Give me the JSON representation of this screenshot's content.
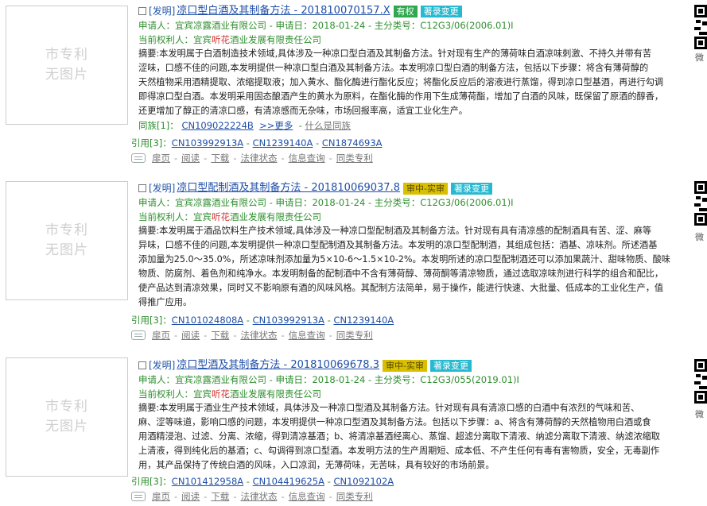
{
  "placeholder": {
    "line1": "市专利",
    "line2": "无图片"
  },
  "entries": [
    {
      "type": "[发明]",
      "title": "凉口型白酒及其制备方法 - 201810070157.X",
      "badges": [
        {
          "text": "有权",
          "color": "#2fa84f"
        },
        {
          "text": "著录变更",
          "color": "#27b9cf"
        }
      ],
      "meta": "申请人：宜宾凉露酒业有限公司 - 申请日：2018-01-24 - 主分类号：C12G3/06(2006.01)I",
      "owner_prefix": "当前权利人：宜宾",
      "owner_red": "听花",
      "owner_suffix": "酒业发展有限责任公司",
      "abstract": [
        "摘要:本发明属于白酒制造技术领域,具体涉及一种凉口型白酒及其制备方法。针对现有生产的薄荷味白酒凉味刺激、不持久并带有苦",
        "涩味，口感不佳的问题,本发明提供一种凉口型白酒及其制备方法。本发明凉口型白酒的制备方法，包括以下步骤：将含有薄荷醇的",
        "天然植物采用酒精提取、浓缩提取液；加入黄水、酯化酶进行酯化反应；将酯化反应后的溶液进行蒸馏，得到凉口型基酒，再进行勾调",
        "即得凉口型白酒。本发明采用固态酿酒产生的黄水为原料，在酯化酶的作用下生成薄荷酯，增加了白酒的风味，既保留了原酒的醇香，",
        "还更增加了醇正的清凉口感，有清凉感而无杂味，市场回报率高，适宜工业化生产。"
      ],
      "same_family": {
        "label": "同族[1]：",
        "link": "CN109022224B",
        "more": ">>更多",
        "what": "什么是同族"
      },
      "cite_label": "引用[3]：",
      "cites": [
        "CN103992913A",
        "CN1239140A",
        "CN1874693A"
      ]
    },
    {
      "type": "[发明]",
      "title": "凉口型配制酒及其制备方法 - 201810069037.8",
      "badges": [
        {
          "text": "审中-实审",
          "color": "#d8c000"
        },
        {
          "text": "著录变更",
          "color": "#27b9cf"
        }
      ],
      "meta": "申请人：宜宾凉露酒业有限公司 - 申请日：2018-01-24 - 主分类号：C12G3/06(2006.01)I",
      "owner_prefix": "当前权利人：宜宾",
      "owner_red": "听花",
      "owner_suffix": "酒业发展有限责任公司",
      "abstract": [
        "摘要:本发明属于酒品饮料生产技术领域,具体涉及一种凉口型配制酒及其制备方法。针对现有具有清凉感的配制酒具有苦、涩、麻等",
        "异味，口感不佳的问题,本发明提供一种凉口型配制酒及其制备方法。本发明的凉口型配制酒，其组成包括：酒基、凉味剂。所述酒基",
        "添加量为25.0～35.0%，所述凉味剂添加量为5×10-6～1.5×10-2%。本发明所述的凉口型配制酒还可以添加果蔬汁、甜味物质、酸味",
        "物质、防腐剂、着色剂和纯净水。本发明制备的配制酒中不含有薄荷醇、薄荷酮等清凉物质，通过选取凉味剂进行科学的组合和配比，",
        "使产品达到清凉效果，同时又不影响原有酒的风味风格。其配制方法简单，易于操作，能进行快速、大批量、低成本的工业化生产，值",
        "得推广应用。"
      ],
      "same_family": null,
      "cite_label": "引用[3]：",
      "cites": [
        "CN101024808A",
        "CN103992913A",
        "CN1239140A"
      ]
    },
    {
      "type": "[发明]",
      "title": "凉口型酒及其制备方法 - 201810069678.3",
      "badges": [
        {
          "text": "审中-实审",
          "color": "#d8c000"
        },
        {
          "text": "著录变更",
          "color": "#27b9cf"
        }
      ],
      "meta": "申请人：宜宾凉露酒业有限公司 - 申请日：2018-01-24 - 主分类号：C12G3/055(2019.01)I",
      "owner_prefix": "当前权利人：宜宾",
      "owner_red": "听花",
      "owner_suffix": "酒业发展有限责任公司",
      "abstract": [
        "摘要:本发明属于酒业生产技术领域，具体涉及一种凉口型酒及其制备方法。针对现有具有清凉口感的白酒中有浓烈的气味和苦、",
        "麻、涩等味道，影响口感的问题，本发明提供一种凉口型酒及其制备方法。包括以下步骤：a、将含有薄荷醇的天然植物用白酒或食",
        "用酒精浸泡、过滤、分离、浓缩，得到清凉基酒；b、将清凉基酒经离心、蒸馏、超滤分离取下清液、纳滤分离取下清液、纳滤浓缩取",
        "上清液，得到纯化后的基酒；c、勾调得到凉口型酒。本发明方法的生产周期短、成本低、不产生任何有毒有害物质，安全，无毒副作",
        "用，其产品保持了传统白酒的风味，入口凉润，无薄荷味，无苦味，具有较好的市场前景。"
      ],
      "same_family": null,
      "cite_label": "引用[3]：",
      "cites": [
        "CN101412958A",
        "CN104419625A",
        "CN1092102A"
      ]
    }
  ],
  "actions": [
    "扉页",
    "阅读",
    "下载",
    "法律状态",
    "信息查询",
    "同类专利"
  ],
  "wx_label": "微"
}
